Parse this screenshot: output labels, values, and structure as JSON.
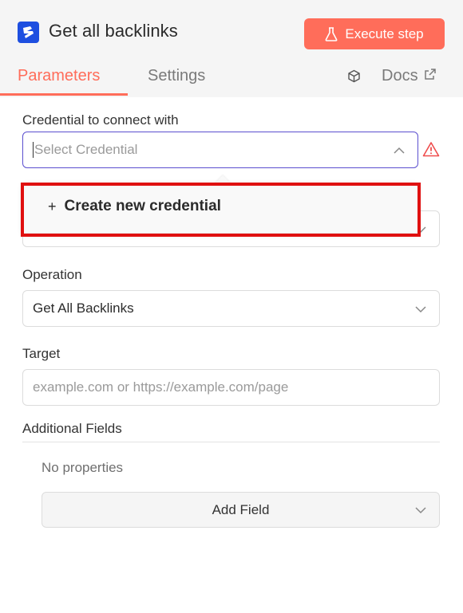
{
  "header": {
    "title": "Get all backlinks",
    "execute_label": "Execute step",
    "accent_color": "#ff6d5a",
    "logo_color": "#1e4fe0"
  },
  "tabs": {
    "parameters": "Parameters",
    "settings": "Settings",
    "docs": "Docs"
  },
  "credential": {
    "label": "Credential to connect with",
    "placeholder": "Select Credential",
    "warning_icon": "warning-triangle-icon"
  },
  "dropdown": {
    "create_prefix": "+",
    "create_label": "Create new credential"
  },
  "operation": {
    "label": "Operation",
    "value": "Get All Backlinks"
  },
  "target": {
    "label": "Target",
    "placeholder": "example.com or https://example.com/page"
  },
  "additional": {
    "label": "Additional Fields",
    "empty_text": "No properties",
    "add_label": "Add Field"
  }
}
